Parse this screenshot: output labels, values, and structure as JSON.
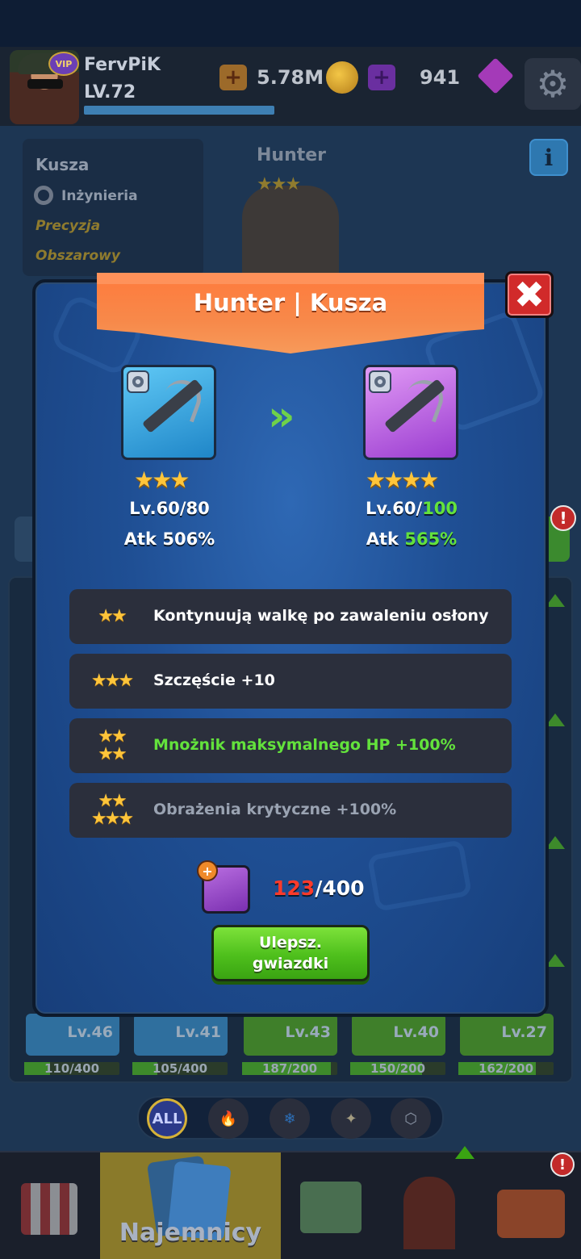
{
  "player": {
    "name": "FervPiK",
    "level": "LV.72",
    "vip": "VIP"
  },
  "currency": {
    "gold_value": "5.78M",
    "gem_value": "941",
    "plus_symbol": "+"
  },
  "hero": {
    "name": "Hunter",
    "weapon_name": "Kusza",
    "class": "Inżynieria",
    "traits": [
      "Precyzja",
      "Obszarowy"
    ],
    "stars": "★★★"
  },
  "modal": {
    "title": "Hunter | Kusza",
    "close_symbol": "✖",
    "upgrade_arrow": "»",
    "current": {
      "stars": "★★★",
      "level_label": "Lv.60/",
      "level_max": "80",
      "atk_label": "Atk ",
      "atk_value": "506%"
    },
    "next": {
      "stars": "★★★★",
      "level_label": "Lv.60/",
      "level_max": "100",
      "atk_label": "Atk ",
      "atk_value": "565%"
    },
    "skills": [
      {
        "stars_top": "★★",
        "stars_bottom": "",
        "text": "Kontynuują walkę po zawaleniu osłony",
        "state": "unlocked"
      },
      {
        "stars_top": "★★★",
        "stars_bottom": "",
        "text": "Szczęście +10",
        "state": "unlocked"
      },
      {
        "stars_top": "★★",
        "stars_bottom": "★★",
        "text": "Mnożnik maksymalnego HP +100%",
        "state": "next"
      },
      {
        "stars_top": "★★",
        "stars_bottom": "★★★",
        "text": "Obrażenia krytyczne +100%",
        "state": "locked"
      }
    ],
    "shards": {
      "have": "123",
      "separator": "/",
      "need": "400",
      "plus": "+"
    },
    "upgrade_button": {
      "line1": "Ulepsz.",
      "line2": "gwiazdki"
    }
  },
  "roster_cards": [
    {
      "level": "Lv.46",
      "progress": "110/400",
      "fraction": 0.275,
      "color": "#2f6f9e"
    },
    {
      "level": "Lv.41",
      "progress": "105/400",
      "fraction": 0.2625,
      "color": "#2f6f9e"
    },
    {
      "level": "Lv.43",
      "progress": "187/200",
      "fraction": 0.935,
      "color": "#3f7f2a"
    },
    {
      "level": "Lv.40",
      "progress": "150/200",
      "fraction": 0.75,
      "color": "#3f7f2a"
    },
    {
      "level": "Lv.27",
      "progress": "162/200",
      "fraction": 0.81,
      "color": "#3f7f2a"
    }
  ],
  "filters": {
    "all": "ALL",
    "fire": "🔥",
    "ice": "❄",
    "star": "✦",
    "nut": "⬡"
  },
  "nav": {
    "mercenaries_label": "Najemnicy",
    "alert": "!"
  },
  "info_symbol": "i",
  "settings_symbol": "⚙",
  "alert_symbol": "!"
}
